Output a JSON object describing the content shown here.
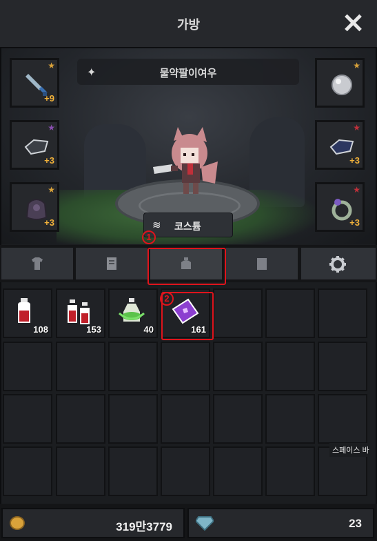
{
  "header": {
    "title": "가방",
    "close_icon": "close-icon"
  },
  "character": {
    "name": "물약팔이여우",
    "name_icon": "sparkle-icon",
    "costume_label": "코스튬",
    "costume_icon": "layers-icon"
  },
  "equipment": {
    "left": [
      {
        "icon": "sword-icon",
        "level": "+9",
        "star_color": "#d9a23a"
      },
      {
        "icon": "dark-stone-icon",
        "level": "+3",
        "star_color": "#8a4fb0"
      },
      {
        "icon": "dark-armor-icon",
        "level": "+3",
        "star_color": "#d9a23a"
      }
    ],
    "right": [
      {
        "icon": "pearl-icon",
        "level": "",
        "star_color": "#d9a23a"
      },
      {
        "icon": "blue-stone-icon",
        "level": "+3",
        "star_color": "#c0303a"
      },
      {
        "icon": "ring-icon",
        "level": "+3",
        "star_color": "#c0303a"
      }
    ]
  },
  "tabs": [
    {
      "name": "armor",
      "icon": "shirt-icon"
    },
    {
      "name": "scroll",
      "icon": "scroll-icon"
    },
    {
      "name": "consumable",
      "icon": "bag-icon",
      "active": true
    },
    {
      "name": "material",
      "icon": "paper-icon"
    },
    {
      "name": "settings",
      "icon": "gear-icon"
    }
  ],
  "inventory": [
    {
      "icon": "red-potion-icon",
      "count": "108"
    },
    {
      "icon": "double-red-potion-icon",
      "count": "153"
    },
    {
      "icon": "green-potion-icon",
      "count": "40"
    },
    {
      "icon": "purple-ticket-icon",
      "count": "161"
    }
  ],
  "tooltip": "스페이스 바",
  "annotations": {
    "one": "1",
    "two": "2",
    "color": "#e0141c"
  },
  "footer": {
    "gold": "319만3779",
    "gold_icon": "coin-icon",
    "gems": "23",
    "gem_icon": "diamond-icon"
  }
}
